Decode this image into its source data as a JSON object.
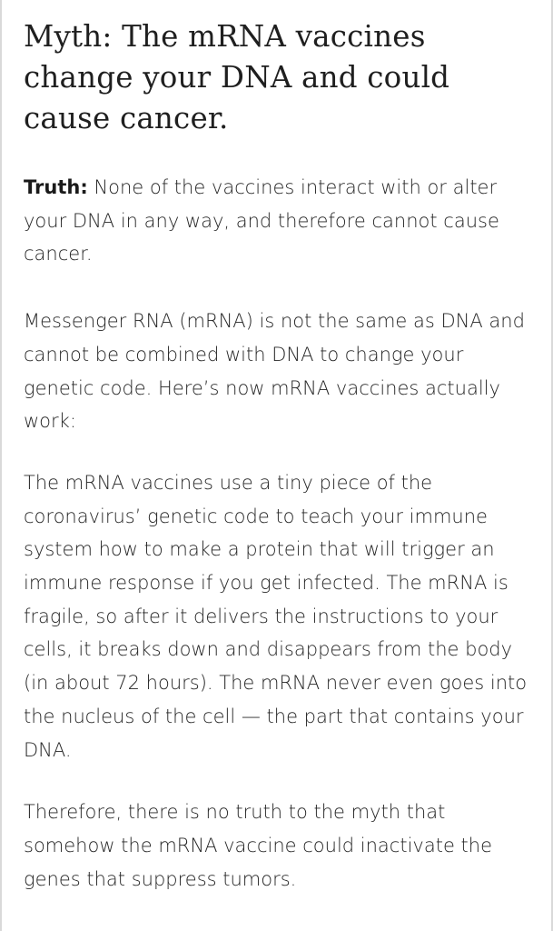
{
  "article": {
    "headline": "Myth: The mRNA vaccines change your DNA and could cause cancer.",
    "truth_label": "Truth:",
    "truth_text": " None of the vaccines interact with or alter your DNA in any way, and therefore cannot cause cancer.",
    "paragraphs": [
      "Messenger RNA (mRNA) is not the same as DNA and cannot be combined with DNA to change your genetic code. Here’s now mRNA vaccines actually work:",
      "The mRNA vaccines use a tiny piece of the coronavirus’ genetic code to teach your immune system how to make a protein that will trigger an immune response if you get infected. The mRNA is fragile, so after it delivers the instructions to your cells, it breaks down and disappears from the body (in about 72 hours). The mRNA never even goes into the nucleus of the cell — the part that contains your DNA.",
      "Therefore, there is no truth to the myth that somehow the mRNA vaccine could inactivate the genes that suppress tumors."
    ]
  }
}
